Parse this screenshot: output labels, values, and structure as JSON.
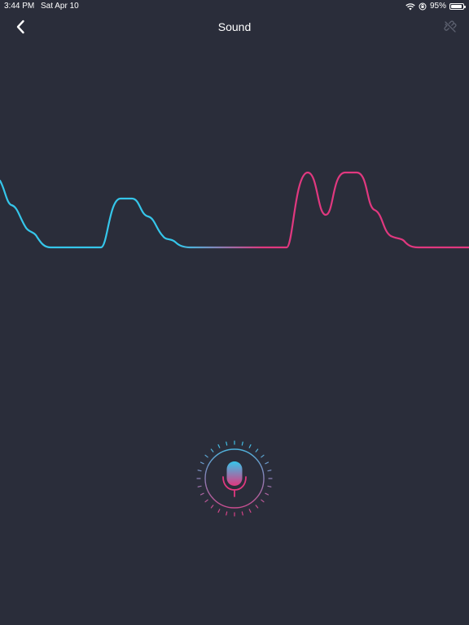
{
  "status_bar": {
    "time": "3:44 PM",
    "date": "Sat Apr 10",
    "battery_percent": "95%",
    "battery_level": 0.95,
    "icons": [
      "wifi-icon",
      "orientation-lock-icon",
      "battery-icon"
    ]
  },
  "nav": {
    "title": "Sound",
    "back_icon": "chevron-left-icon",
    "right_icon": "link-off-icon"
  },
  "visualizer": {
    "colors": {
      "cyan": "#35c6ea",
      "pink": "#e0387f",
      "background": "#2a2d3a"
    }
  },
  "microphone": {
    "icon": "microphone-icon",
    "ring_color_top": "#35c6ea",
    "ring_color_bottom": "#e0387f"
  }
}
